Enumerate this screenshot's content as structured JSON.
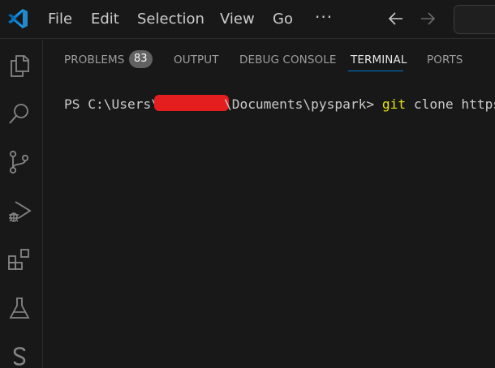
{
  "menu": {
    "items": [
      "File",
      "Edit",
      "Selection",
      "View",
      "Go"
    ],
    "more": "···"
  },
  "icons": {
    "app": "vscode-logo-icon",
    "back": "arrow-left-icon",
    "forward": "arrow-right-icon",
    "explorer": "files-icon",
    "search": "search-icon",
    "source_control": "source-control-icon",
    "run_debug": "run-debug-icon",
    "extensions": "extensions-icon",
    "testing": "flask-icon",
    "extra": "s-logo-icon"
  },
  "panel": {
    "tabs": [
      {
        "label": "PROBLEMS",
        "badge": "83"
      },
      {
        "label": "OUTPUT"
      },
      {
        "label": "DEBUG CONSOLE"
      },
      {
        "label": "TERMINAL",
        "active": true
      },
      {
        "label": "PORTS"
      }
    ]
  },
  "terminal": {
    "prompt_start": "PS C:\\Users\\",
    "prompt_end": "\\Documents\\pyspark> ",
    "command": "git",
    "args": " clone https://"
  },
  "colors": {
    "background": "#181818",
    "accent": "#0078d4",
    "vscode_blue": "#2489ca",
    "command_yellow": "#e5e510",
    "redaction_red": "#e41e1e"
  }
}
